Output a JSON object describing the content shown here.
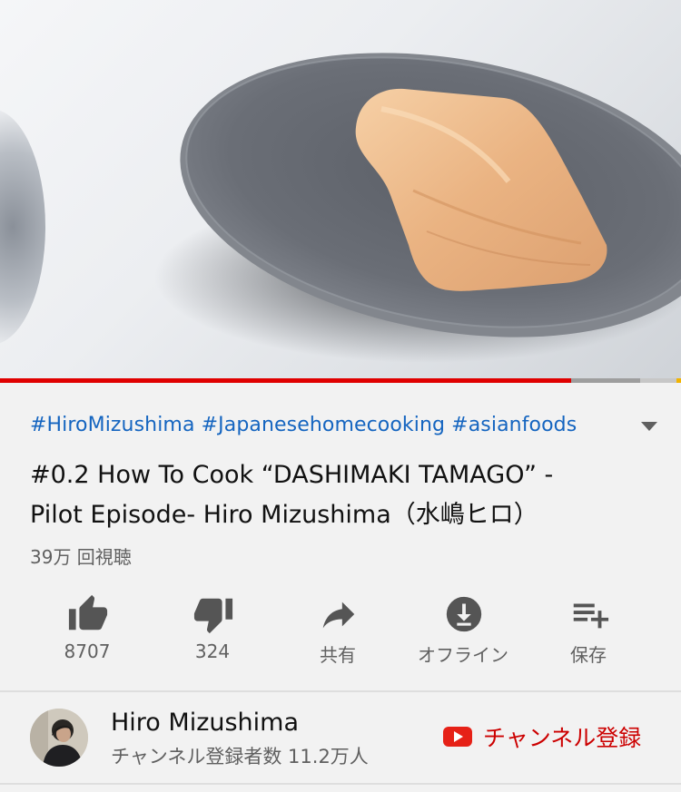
{
  "video": {
    "progress": 0.838,
    "buffered": 0.94
  },
  "details": {
    "hashtags": "#HiroMizushima #Japanesehomecooking #asianfoods",
    "title_line1": "#0.2 How To Cook “DASHIMAKI TAMAGO” -",
    "title_line2": "Pilot Episode-  Hiro Mizushima（水嶋ヒロ）",
    "views": "39万 回視聴"
  },
  "actions": [
    {
      "icon": "thumbs-up-icon",
      "label": "8707"
    },
    {
      "icon": "thumbs-down-icon",
      "label": "324"
    },
    {
      "icon": "share-icon",
      "label": "共有"
    },
    {
      "icon": "download-icon",
      "label": "オフライン"
    },
    {
      "icon": "playlist-add-icon",
      "label": "保存"
    }
  ],
  "channel": {
    "name": "Hiro Mizushima",
    "subscribers": "チャンネル登録者数 11.2万人",
    "subscribe_label": "チャンネル登録"
  },
  "colors": {
    "link": "#1565c0",
    "progress": "#e00000",
    "subscribe": "#cc0000",
    "secondary_text": "#606060"
  }
}
